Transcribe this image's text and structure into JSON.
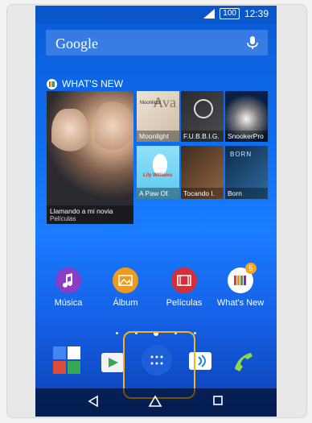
{
  "status_bar": {
    "battery": "100",
    "time": "12:39"
  },
  "search": {
    "label": "Google"
  },
  "whats_new_widget": {
    "header": "WHAT'S NEW",
    "featured": {
      "title": "Llamando a mi novia",
      "category": "Películas"
    },
    "items": [
      {
        "title": "Moonlight",
        "art_text_1": "Ava",
        "art_text_2": "Moonlight"
      },
      {
        "title": "F.U.B.B.I.G."
      },
      {
        "title": "SnookerPro"
      },
      {
        "title": "A Paw Of.",
        "art_text": "Lily Williams"
      },
      {
        "title": "Tocando l."
      },
      {
        "title": "Born",
        "art_text": "BORN"
      }
    ]
  },
  "apps": [
    {
      "label": "Música"
    },
    {
      "label": "Álbum"
    },
    {
      "label": "Películas"
    },
    {
      "label": "What's New",
      "badge": "5"
    }
  ],
  "page_indicator": {
    "count": 5,
    "active_index": 2
  },
  "dock": [
    {
      "name": "google-apps-folder"
    },
    {
      "name": "play-store"
    },
    {
      "name": "app-drawer"
    },
    {
      "name": "messaging"
    },
    {
      "name": "phone"
    }
  ],
  "colors": {
    "highlight": "#f5b51a",
    "accent": "#1e5fd8"
  }
}
